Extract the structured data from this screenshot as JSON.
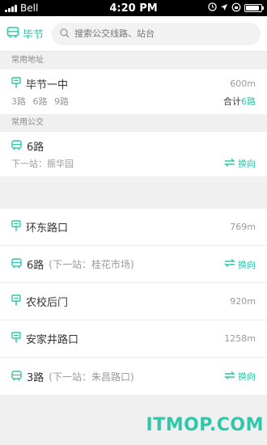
{
  "status_bar": {
    "carrier": "Bell",
    "time": "4:20 PM"
  },
  "header": {
    "city": "毕节",
    "search_placeholder": "搜索公交线路、站台"
  },
  "frequent_places": {
    "title": "常用地址",
    "item": {
      "name": "毕节一中",
      "distance": "600m",
      "routes": [
        "3路",
        "6路",
        "9路"
      ],
      "total_label": "合计",
      "total_count": "6路"
    }
  },
  "frequent_bus": {
    "title": "常用公交",
    "item": {
      "name": "6路",
      "next_stop": "下一站：振华园",
      "swap_label": "换向"
    }
  },
  "list": [
    {
      "type": "stop",
      "name": "环东路口",
      "distance": "769m"
    },
    {
      "type": "bus",
      "name": "6路",
      "next": "(下一站：桂花市场)",
      "swap": "换向"
    },
    {
      "type": "stop",
      "name": "农校后门",
      "distance": "920m"
    },
    {
      "type": "stop",
      "name": "安家井路口",
      "distance": "1258m"
    },
    {
      "type": "bus",
      "name": "3路",
      "next": "(下一站：朱昌路口)",
      "swap": "换向"
    }
  ],
  "watermark": "ITMOP.COM",
  "colors": {
    "accent": "#2fc7a9"
  }
}
